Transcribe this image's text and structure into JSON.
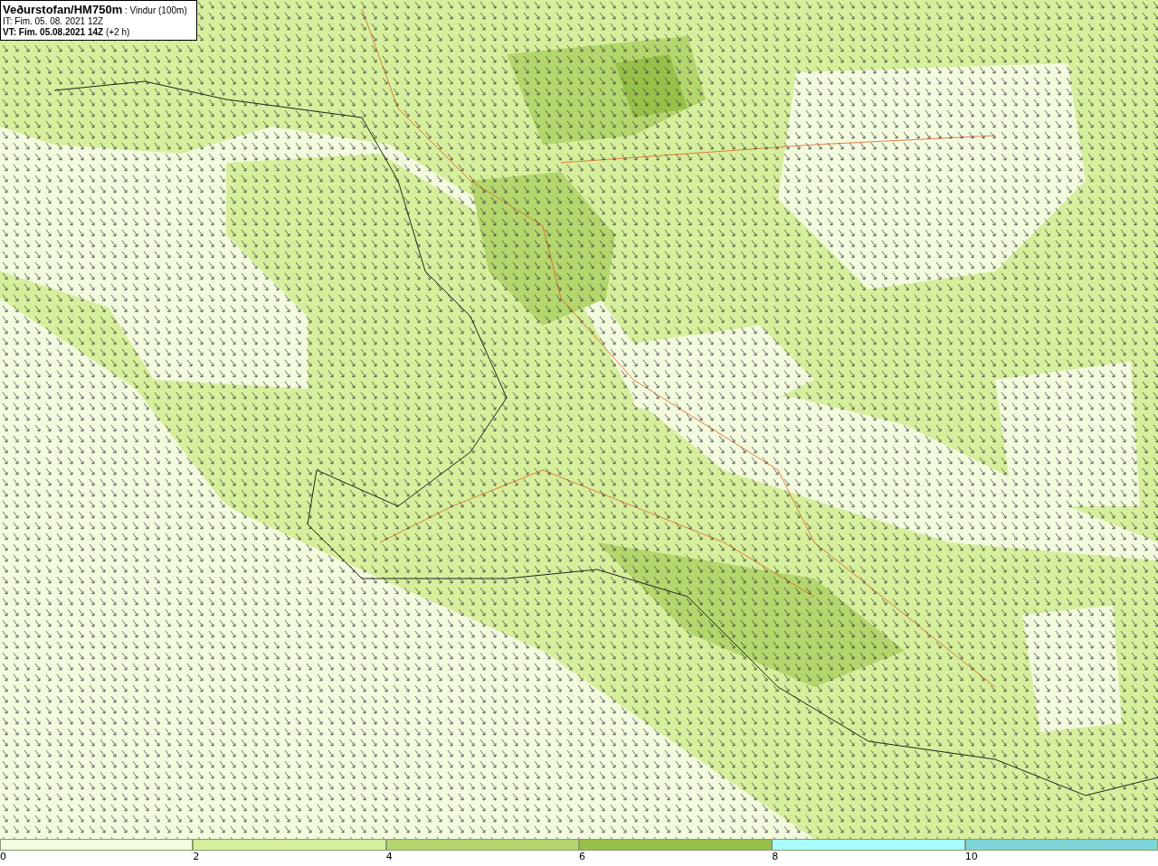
{
  "title_box": {
    "lines": [
      {
        "kind": "heading",
        "text": "**Veðurstofan/HM750m** : Vindur (100m)"
      },
      {
        "kind": "plain",
        "text": "IT: Fim. 05. 08. 2021 12Z"
      },
      {
        "kind": "plain",
        "text": "**VT: Fim. 05.08.2021 14Z** (+2 h)"
      }
    ]
  },
  "legend": {
    "segments": [
      {
        "label": "0",
        "color": "#f3fbdf"
      },
      {
        "label": "2",
        "color": "#d6ef9c"
      },
      {
        "label": "4",
        "color": "#b3d66d"
      },
      {
        "label": "6",
        "color": "#97c049"
      },
      {
        "label": "8",
        "color": "#a9fcfe"
      },
      {
        "label": "10",
        "color": "#7ed6d9"
      }
    ]
  }
}
